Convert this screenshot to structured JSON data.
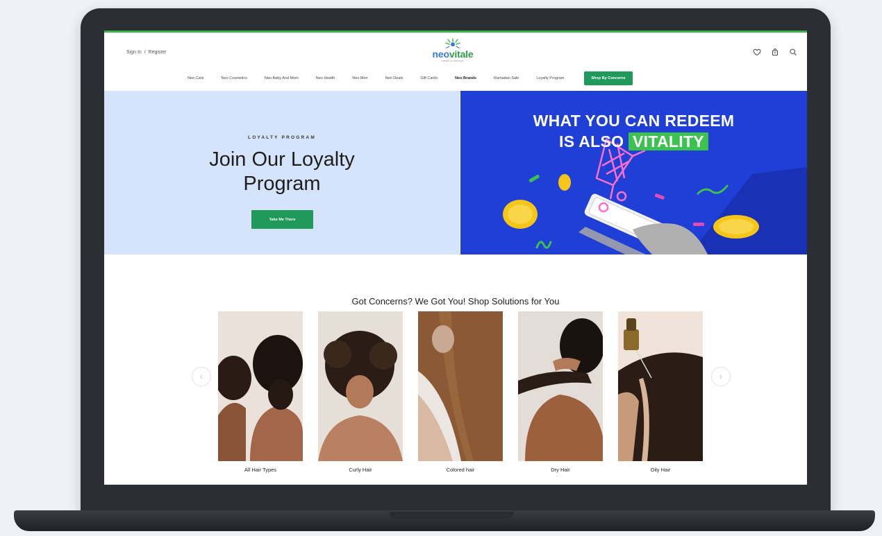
{
  "header": {
    "sign_in": "Sign In",
    "separator": "/",
    "register": "Register",
    "logo": {
      "part1": "neo",
      "part2": "vitale",
      "tagline": "health & wellness"
    },
    "icons": [
      "heart-icon",
      "bag-icon",
      "search-icon"
    ]
  },
  "nav": {
    "items": [
      {
        "label": "Neo Care",
        "bold": false
      },
      {
        "label": "Neo Cosmetics",
        "bold": false
      },
      {
        "label": "Neo Baby And Mom",
        "bold": false
      },
      {
        "label": "Neo Health",
        "bold": false
      },
      {
        "label": "Neo Men",
        "bold": false
      },
      {
        "label": "Neo Deals",
        "bold": false
      },
      {
        "label": "Gift Cards",
        "bold": false
      },
      {
        "label": "Neo Brands",
        "bold": true
      },
      {
        "label": "Ramadan Sale",
        "bold": false
      },
      {
        "label": "Loyalty Program",
        "bold": false
      }
    ],
    "cta": "Shop By Concerns"
  },
  "hero": {
    "eyebrow": "LOYALTY PROGRAM",
    "title": "Join Our Loyalty Program",
    "button": "Take Me There",
    "promo_line1": "WHAT YOU CAN REDEEM",
    "promo_line2_prefix": "IS ALSO",
    "promo_line2_highlight": "VITALITY"
  },
  "concerns": {
    "title": "Got Concerns? We Got You! Shop Solutions for You",
    "prev": "‹",
    "next": "›",
    "cards": [
      {
        "label": "All Hair Types"
      },
      {
        "label": "Curly Hair"
      },
      {
        "label": "Colored hair"
      },
      {
        "label": "Dry Hair"
      },
      {
        "label": "Oily Hair"
      }
    ]
  },
  "colors": {
    "accent_green": "#1f9a5a",
    "hero_left_bg": "#d6e4fb",
    "promo_blue": "#1f3fd6",
    "highlight_green": "#3cc24f"
  }
}
